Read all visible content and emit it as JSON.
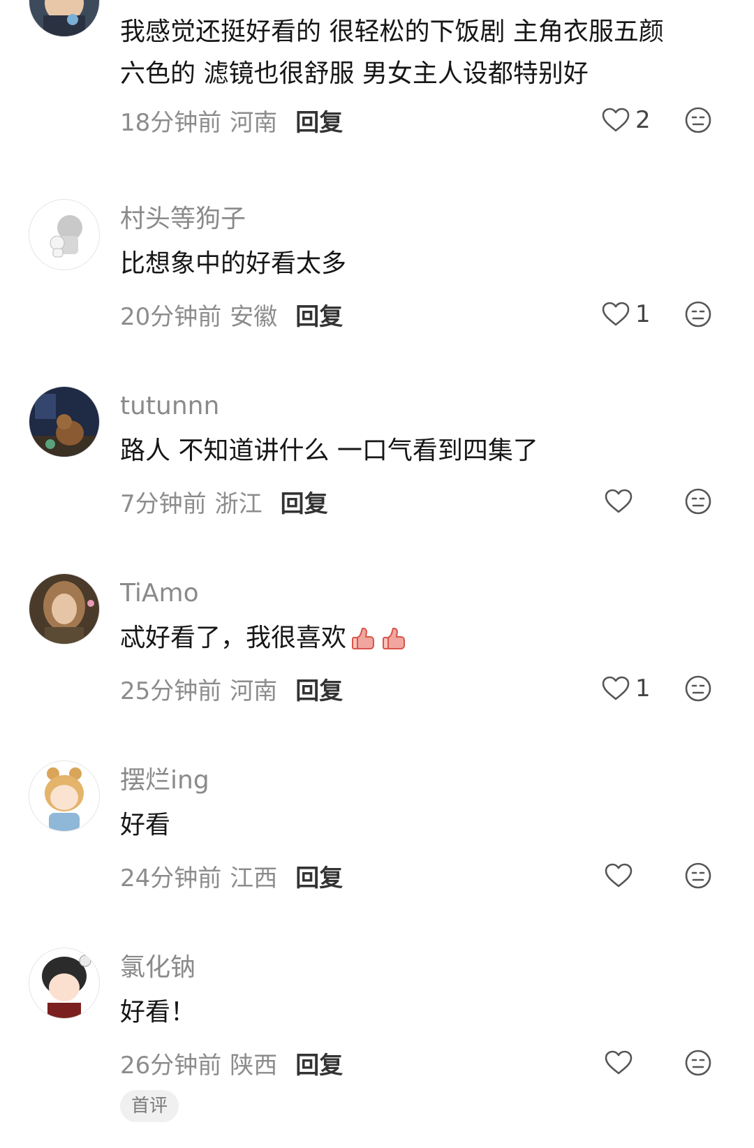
{
  "comments": [
    {
      "username": "",
      "lines": [
        "我感觉还挺好看的 很轻松的下饭剧 主角衣服五颜",
        "六色的 滤镜也很舒服 男女主人设都特别好"
      ],
      "time": "18分钟前",
      "location": "河南",
      "reply": "回复",
      "likes": "2"
    },
    {
      "username": "村头等狗子",
      "lines": [
        "比想象中的好看太多"
      ],
      "time": "20分钟前",
      "location": "安徽",
      "reply": "回复",
      "likes": "1"
    },
    {
      "username": "tutunnn",
      "lines": [
        "路人 不知道讲什么 一口气看到四集了"
      ],
      "time": "7分钟前",
      "location": "浙江",
      "reply": "回复",
      "likes": ""
    },
    {
      "username": "TiAmo",
      "lines": [
        "忒好看了，我很喜欢"
      ],
      "time": "25分钟前",
      "location": "河南",
      "reply": "回复",
      "likes": "1",
      "emoji": "thumbs-up-icon"
    },
    {
      "username": "摆烂ing",
      "lines": [
        "好看"
      ],
      "time": "24分钟前",
      "location": "江西",
      "reply": "回复",
      "likes": ""
    },
    {
      "username": "氯化钠",
      "lines": [
        "好看！"
      ],
      "time": "26分钟前",
      "location": "陕西",
      "reply": "回复",
      "likes": "",
      "badge": "首评"
    }
  ],
  "icons": {
    "like": "heart-outline-icon",
    "dislike": "neutral-face-icon"
  },
  "colors": {
    "meta_text": "#8c8c8c",
    "username": "#8a8a8a",
    "badge_bg": "#f0f0f0"
  }
}
